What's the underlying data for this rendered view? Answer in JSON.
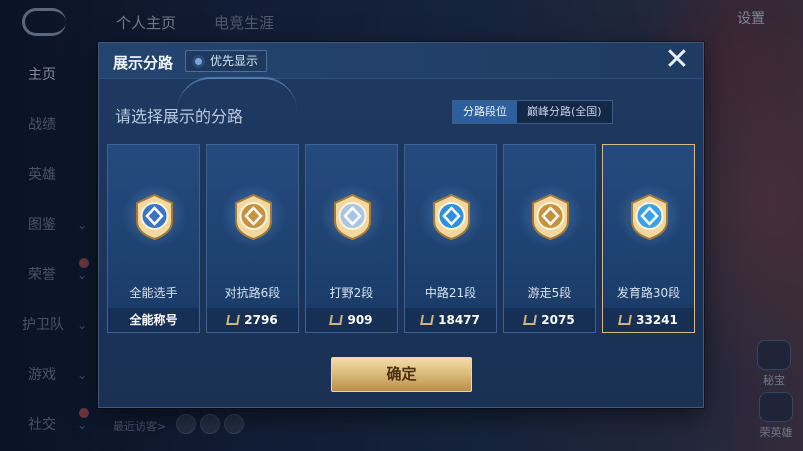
{
  "top_tabs": [
    "个人主页",
    "电竞生涯"
  ],
  "settings_label": "设置",
  "side_nav": [
    {
      "label": "主页",
      "active": true
    },
    {
      "label": "战绩"
    },
    {
      "label": "英雄"
    },
    {
      "label": "图鉴"
    },
    {
      "label": "荣誉"
    },
    {
      "label": "护卫队"
    },
    {
      "label": "游戏"
    },
    {
      "label": "社交"
    }
  ],
  "recent_visit": "最近访客>",
  "right_buttons": [
    "秘宝",
    "荣英雄"
  ],
  "dialog": {
    "title": "展示分路",
    "pref_label": "优先显示",
    "close_icon": "close-icon",
    "subtitle": "请选择展示的分路",
    "tabs": [
      {
        "label": "分路段位",
        "active": true
      },
      {
        "label": "巅峰分路(全国)",
        "active": false
      }
    ],
    "cards": [
      {
        "label": "全能选手",
        "value": "全能称号",
        "badge_color": "#3a74c9",
        "selected": false
      },
      {
        "label": "对抗路6段",
        "value": "2796",
        "badge_color": "#c7923f",
        "selected": false
      },
      {
        "label": "打野2段",
        "value": "909",
        "badge_color": "#a8c4e6",
        "selected": false
      },
      {
        "label": "中路21段",
        "value": "18477",
        "badge_color": "#2f8fe0",
        "selected": false
      },
      {
        "label": "游走5段",
        "value": "2075",
        "badge_color": "#c7923f",
        "selected": false
      },
      {
        "label": "发育路30段",
        "value": "33241",
        "badge_color": "#3aa0ea",
        "selected": true
      }
    ],
    "confirm_label": "确定"
  }
}
